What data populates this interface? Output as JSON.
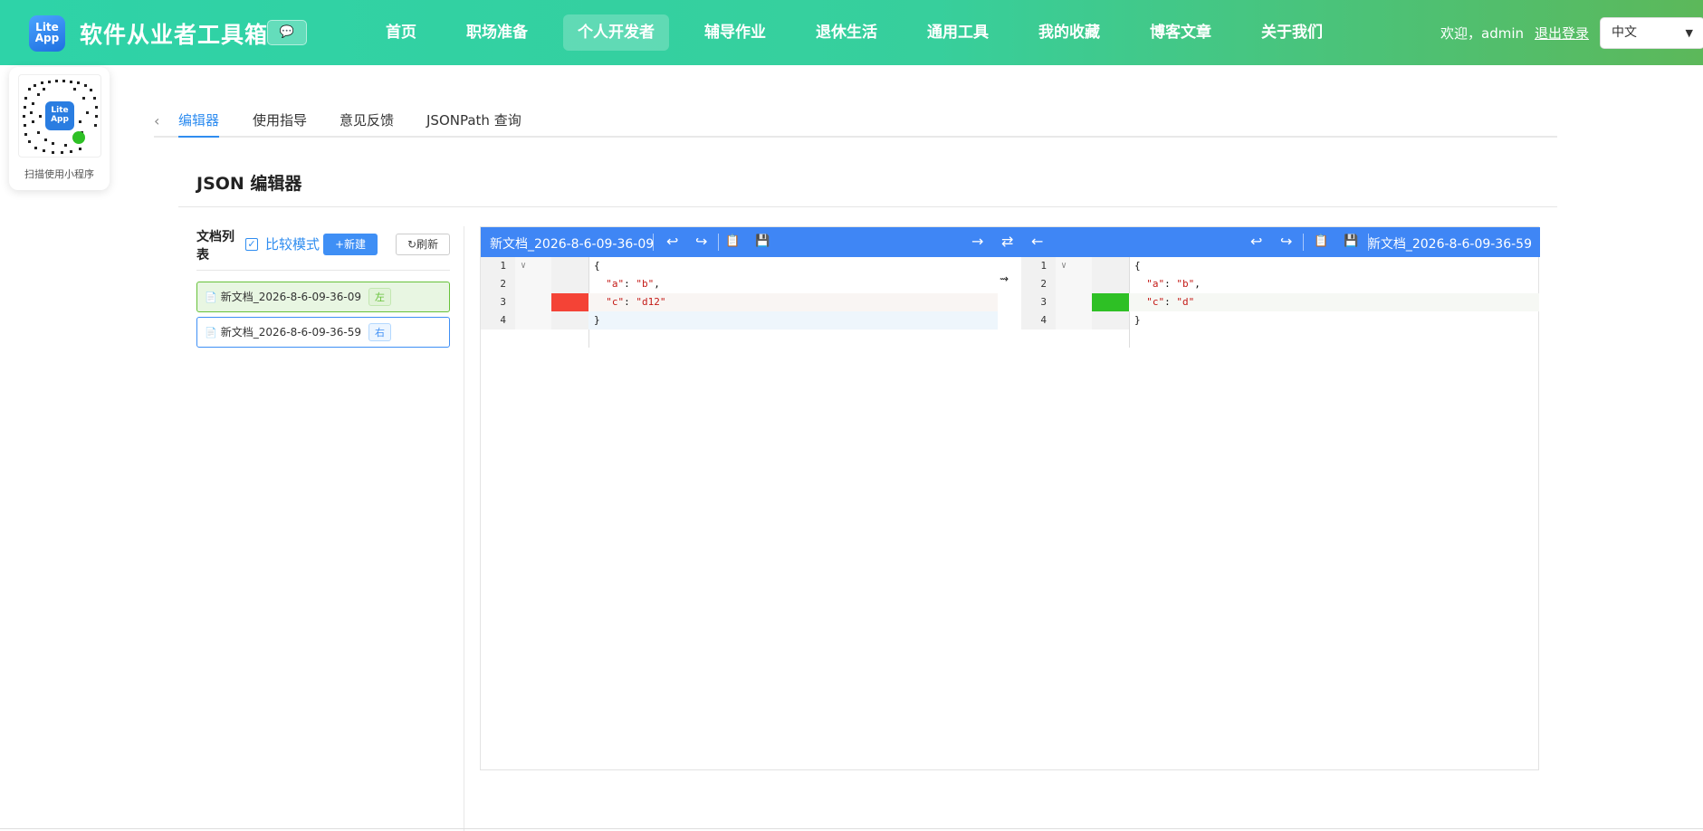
{
  "header": {
    "logo_text_1": "Lite",
    "logo_text_2": "App",
    "title": "软件从业者工具箱",
    "nav": [
      "首页",
      "职场准备",
      "个人开发者",
      "辅导作业",
      "退休生活",
      "通用工具",
      "我的收藏",
      "博客文章",
      "关于我们"
    ],
    "active_nav": "个人开发者",
    "welcome": "欢迎，admin",
    "logout": "退出登录",
    "language": "中文"
  },
  "qr": {
    "caption": "扫描使用小程序",
    "badge_1": "Lite",
    "badge_2": "App"
  },
  "tabs": [
    "编辑器",
    "使用指导",
    "意见反馈",
    "JSONPath 查询"
  ],
  "page_title": "JSON 编辑器",
  "sidebar": {
    "list_label": "文档列表",
    "compare_label": "比较模式",
    "compare_checked": true,
    "new_button": "+新建",
    "refresh_button": "刷新",
    "docs": [
      {
        "name": "新文档_2026-8-6-09-36-09",
        "tag": "左"
      },
      {
        "name": "新文档_2026-8-6-09-36-59",
        "tag": "右"
      }
    ]
  },
  "editor": {
    "left_title": "新文档_2026-8-6-09-36-09",
    "right_title": "新文档_2026-8-6-09-36-59",
    "left_lines": [
      "{",
      "  \"a\": \"b\",",
      "  \"c\": \"d12\"",
      "}"
    ],
    "right_lines": [
      "{",
      "  \"a\": \"b\",",
      "  \"c\": \"d\"",
      "}"
    ],
    "line_numbers": [
      "1",
      "2",
      "3",
      "4"
    ],
    "diff_line": 3,
    "colors": {
      "removed": "#f44336",
      "added": "#2ec025",
      "toolbar": "#3f86f5"
    }
  },
  "colors": {
    "accent": "#2f8df0",
    "header_start": "#2ed3a8",
    "header_end": "#5cb85a"
  }
}
